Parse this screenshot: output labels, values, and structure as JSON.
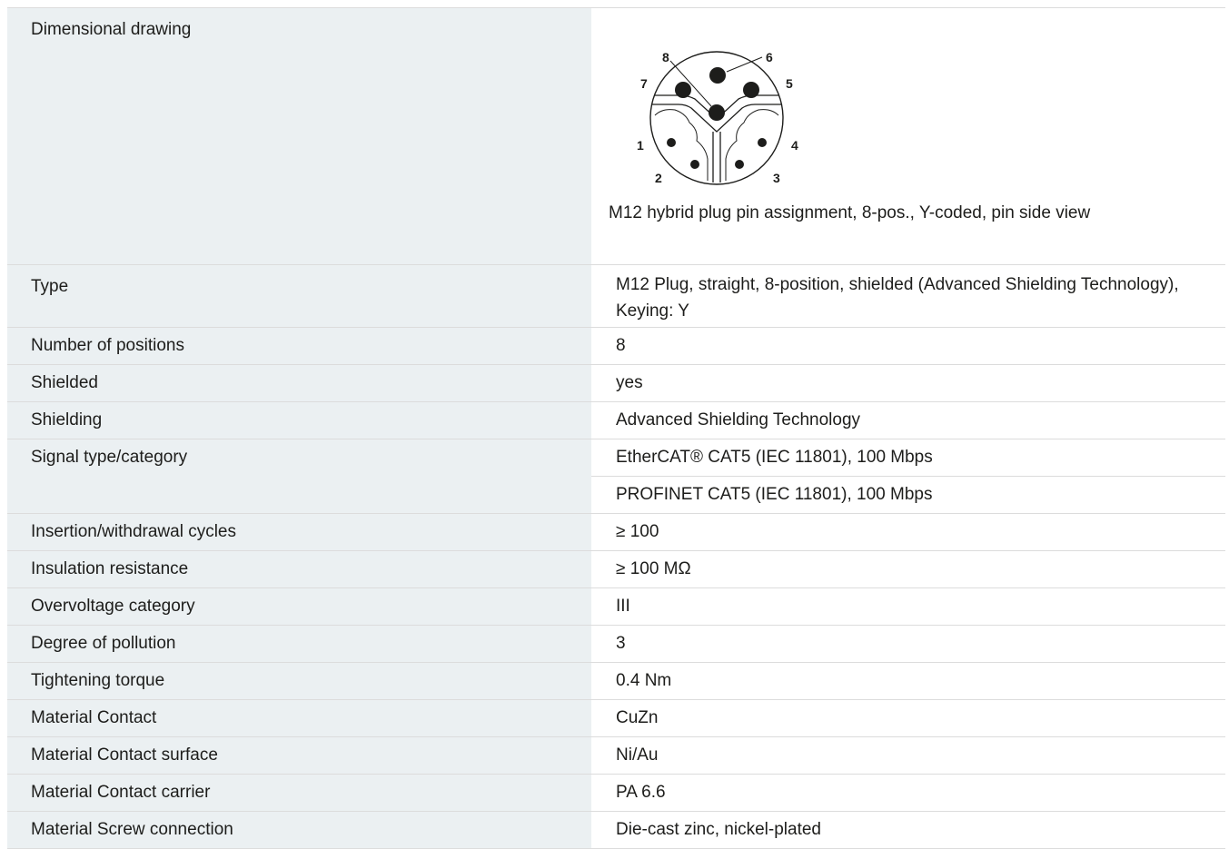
{
  "drawing": {
    "label": "Dimensional drawing",
    "caption": "M12 hybrid plug pin assignment, 8-pos., Y-coded, pin side view",
    "pins": [
      "1",
      "2",
      "3",
      "4",
      "5",
      "6",
      "7",
      "8"
    ]
  },
  "rows": [
    {
      "label": "Type",
      "values": [
        "M12 Plug, straight, 8-position, shielded (Advanced Shielding Technology), Keying: Y"
      ]
    },
    {
      "label": "Number of positions",
      "values": [
        "8"
      ]
    },
    {
      "label": "Shielded",
      "values": [
        "yes"
      ]
    },
    {
      "label": "Shielding",
      "values": [
        "Advanced Shielding Technology"
      ]
    },
    {
      "label": "Signal type/category",
      "values": [
        "EtherCAT® CAT5 (IEC 11801), 100 Mbps",
        "PROFINET CAT5 (IEC 11801), 100 Mbps"
      ]
    },
    {
      "label": "Insertion/withdrawal cycles",
      "values": [
        "≥ 100"
      ]
    },
    {
      "label": "Insulation resistance",
      "values": [
        "≥ 100 MΩ"
      ]
    },
    {
      "label": "Overvoltage category",
      "values": [
        "III"
      ]
    },
    {
      "label": "Degree of pollution",
      "values": [
        "3"
      ]
    },
    {
      "label": "Tightening torque",
      "values": [
        "0.4 Nm"
      ]
    },
    {
      "label": "Material Contact",
      "values": [
        "CuZn"
      ]
    },
    {
      "label": "Material Contact surface",
      "values": [
        "Ni/Au"
      ]
    },
    {
      "label": "Material Contact carrier",
      "values": [
        "PA 6.6"
      ]
    },
    {
      "label": "Material Screw connection",
      "values": [
        "Die-cast zinc, nickel-plated"
      ]
    }
  ]
}
